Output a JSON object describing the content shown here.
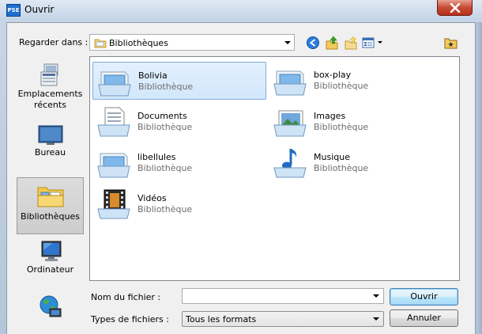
{
  "window": {
    "title": "Ouvrir",
    "app_badge": "PSE"
  },
  "lookin": {
    "label": "Regarder dans :",
    "value": "Bibliothèques"
  },
  "places": [
    {
      "label": "Emplacements récents",
      "icon": "recent-places-icon"
    },
    {
      "label": "Bureau",
      "icon": "desktop-icon"
    },
    {
      "label": "Bibliothèques",
      "icon": "libraries-icon",
      "selected": true
    },
    {
      "label": "Ordinateur",
      "icon": "computer-icon"
    },
    {
      "label": "",
      "icon": "network-icon"
    }
  ],
  "files": [
    {
      "name": "Bolivia",
      "type": "Bibliothèque",
      "icon": "library-folder-icon",
      "selected": true
    },
    {
      "name": "box-play",
      "type": "Bibliothèque",
      "icon": "library-folder-icon"
    },
    {
      "name": "Documents",
      "type": "Bibliothèque",
      "icon": "documents-library-icon"
    },
    {
      "name": "Images",
      "type": "Bibliothèque",
      "icon": "pictures-library-icon"
    },
    {
      "name": "libellules",
      "type": "Bibliothèque",
      "icon": "library-folder-icon"
    },
    {
      "name": "Musique",
      "type": "Bibliothèque",
      "icon": "music-library-icon"
    },
    {
      "name": "Vidéos",
      "type": "Bibliothèque",
      "icon": "videos-library-icon"
    }
  ],
  "form": {
    "filename_label": "Nom du fichier :",
    "filename_value": "",
    "filetype_label": "Types de fichiers :",
    "filetype_value": "Tous les formats",
    "open_label": "Ouvrir",
    "cancel_label": "Annuler"
  },
  "colors": {
    "selection": "#d2e7fc",
    "selection_border": "#84acdd",
    "titlebar": "#c3d3e6",
    "close": "#c74a35"
  }
}
